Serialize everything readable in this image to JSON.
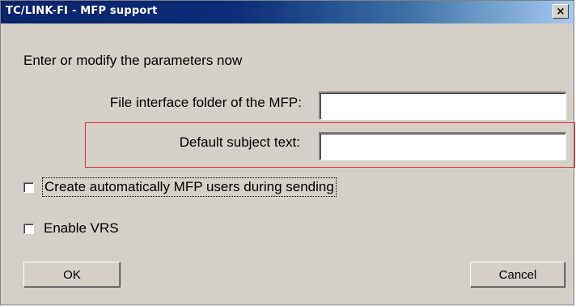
{
  "window": {
    "title": "TC/LINK-FI - MFP support",
    "close_glyph": "×"
  },
  "form": {
    "instruction": "Enter or modify the parameters now",
    "folder_label": "File interface folder of the MFP:",
    "folder_value": "",
    "subject_label": "Default subject text:",
    "subject_value": ""
  },
  "options": {
    "auto_create_label": "Create automatically MFP users during sending",
    "auto_create_checked": false,
    "vrs_label": "Enable VRS",
    "vrs_checked": false
  },
  "buttons": {
    "ok_label": "OK",
    "cancel_label": "Cancel"
  },
  "colors": {
    "title_bar": "#0a246a",
    "dialog_bg": "#d4d0c8",
    "highlight": "#e03030"
  }
}
